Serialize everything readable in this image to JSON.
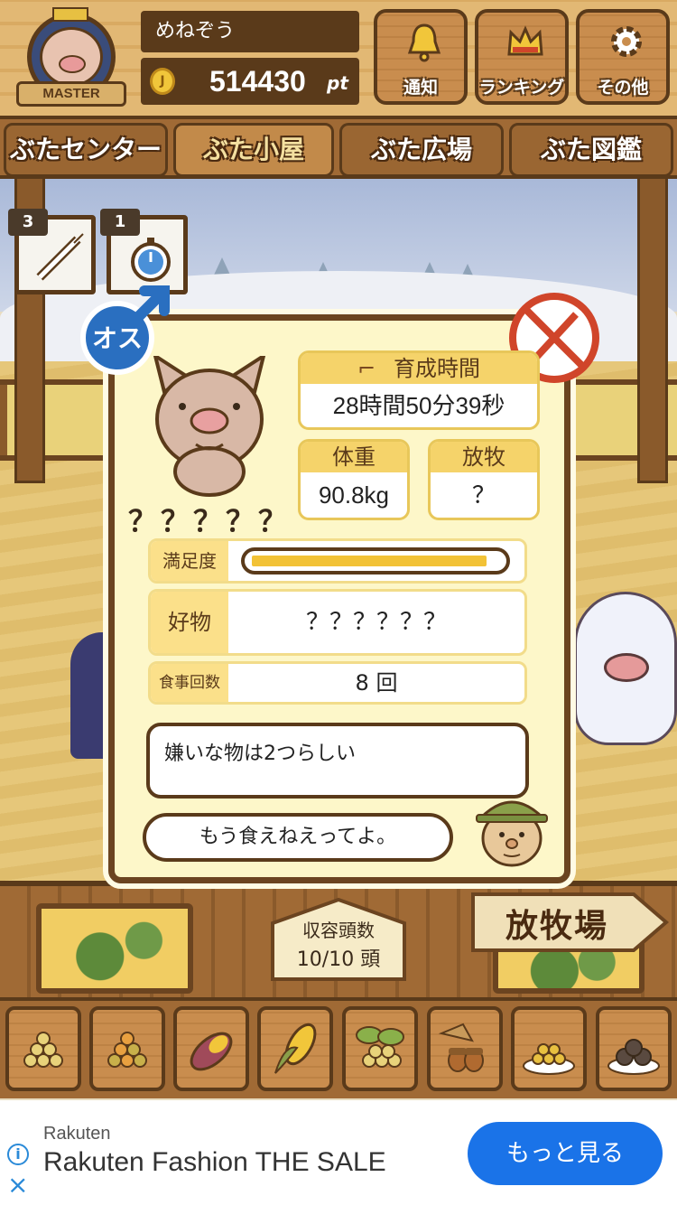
{
  "header": {
    "rank_badge": "MASTER",
    "user_name": "めねぞう",
    "points_value": "514430",
    "points_unit": "pt",
    "coin_glyph": "J",
    "buttons": [
      {
        "label": "通知",
        "icon": "bell-icon"
      },
      {
        "label": "ランキング",
        "icon": "crown-icon"
      },
      {
        "label": "その他",
        "icon": "gear-icon"
      }
    ]
  },
  "nav": {
    "tabs": [
      "ぶたセンター",
      "ぶた小屋",
      "ぶた広場",
      "ぶた図鑑"
    ],
    "active": "ぶた小屋"
  },
  "items": [
    {
      "count": "3",
      "icon": "syringe-icon"
    },
    {
      "count": "1",
      "icon": "stopwatch-icon"
    }
  ],
  "pig": {
    "gender_label": "オス",
    "name": "？？？？？",
    "raise_time_label": "育成時間",
    "raise_time_value": "28時間50分39秒",
    "weight_label": "体重",
    "weight_value": "90.8kg",
    "grazing_label": "放牧",
    "grazing_value": "？",
    "satisfaction_label": "満足度",
    "satisfaction_fraction": 0.95,
    "favorite_label": "好物",
    "favorite_value": "？？？？？？",
    "meals_label": "食事回数",
    "meals_value": "8 回"
  },
  "speech": {
    "hint": "嫌いな物は2つらしい",
    "farmer_line": "もう食えねえってよ。"
  },
  "capacity": {
    "label": "収容頭数",
    "value": "10/10 頭"
  },
  "ranch_sign": "放牧場",
  "feeds": [
    "beans-icon",
    "mixed-beans-icon",
    "sweet-potato-icon",
    "corn-icon",
    "leafy-beans-icon",
    "acorn-icon",
    "bean-plate-icon",
    "meatball-plate-icon"
  ],
  "ad": {
    "advertiser": "Rakuten",
    "headline": "Rakuten Fashion THE SALE",
    "cta": "もっと見る"
  },
  "colors": {
    "wood": "#a06a35",
    "wood_dark": "#5a3a1a",
    "panel_bg": "#fdf7c9",
    "label_yellow": "#f5d36a",
    "male_blue": "#2a6fc0",
    "no_red": "#d0452a",
    "ad_blue": "#1a73e8"
  }
}
